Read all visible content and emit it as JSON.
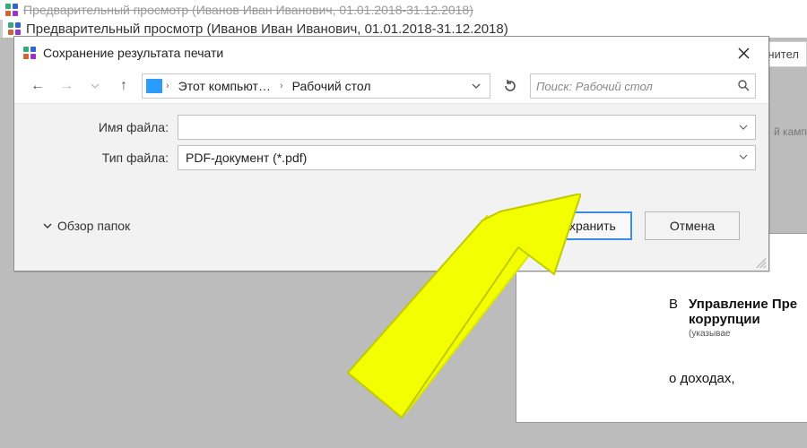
{
  "background": {
    "title_struck": "Предварительный просмотр (Иванов Иван Иванович, 01.01.2018-31.12.2018)",
    "title_main": "Предварительный просмотр (Иванов Иван Иванович, 01.01.2018-31.12.2018)",
    "partial_btn": "нител",
    "partial_text": "й камп"
  },
  "document": {
    "prefix": "В",
    "line1": "Управление Пре",
    "line2": "коррупции",
    "sub": "(указывае",
    "income": "о доходах,"
  },
  "dialog": {
    "title": "Сохранение результата печати",
    "breadcrumb": {
      "loc1": "Этот компьют…",
      "loc2": "Рабочий стол"
    },
    "search_placeholder": "Поиск: Рабочий стол",
    "filename_label": "Имя файла:",
    "filename_value": "",
    "filetype_label": "Тип файла:",
    "filetype_value": "PDF-документ (*.pdf)",
    "browse_label": "Обзор папок",
    "save_label": "Сохранить",
    "cancel_label": "Отмена"
  },
  "arrow_color": "#f3ff00"
}
